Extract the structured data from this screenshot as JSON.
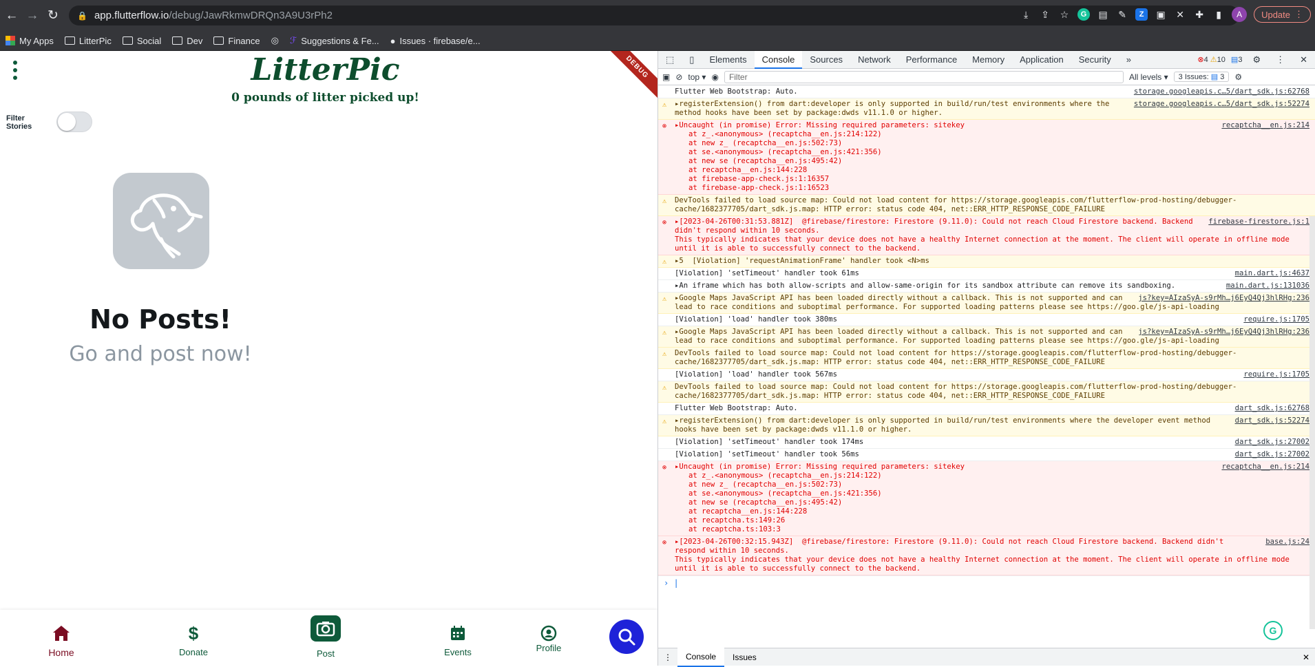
{
  "browser": {
    "url_host": "app.flutterflow.io",
    "url_path": "/debug/JawRkmwDRQn3A9U3rPh2",
    "update_label": "Update",
    "avatar_initial": "A",
    "bookmarks": [
      "My Apps",
      "LitterPic",
      "Social",
      "Dev",
      "Finance",
      "Suggestions & Fe...",
      "Issues · firebase/e..."
    ]
  },
  "app": {
    "title": "LitterPic",
    "tagline": "0 pounds of litter picked up!",
    "filter_label": "Filter Stories",
    "filter_on": false,
    "debug_banner": "DEBUG",
    "empty_title": "No Posts!",
    "empty_subtitle": "Go and post now!",
    "nav": {
      "home": "Home",
      "donate": "Donate",
      "post": "Post",
      "events": "Events",
      "profile": "Profile"
    },
    "colors": {
      "brand": "#0d4d2d",
      "active": "#7a0c22",
      "fab": "#1e22d8"
    }
  },
  "devtools": {
    "tabs": [
      "Elements",
      "Console",
      "Sources",
      "Network",
      "Performance",
      "Memory",
      "Application",
      "Security"
    ],
    "error_count": "4",
    "warning_count": "10",
    "info_count": "3",
    "context": "top",
    "filter_placeholder": "Filter",
    "levels": "All levels",
    "issues_label": "3 Issues:",
    "issues_count": "3",
    "drawer_tabs": [
      "Console",
      "Issues"
    ],
    "messages": [
      {
        "level": "log",
        "text": "Flutter Web Bootstrap: Auto.",
        "src": "storage.googleapis.c…5/dart_sdk.js:62768"
      },
      {
        "level": "warn",
        "text": "▸registerExtension() from dart:developer is only supported in build/run/test environments where the method hooks have been set by package:dwds v11.1.0 or higher.",
        "src": "storage.googleapis.c…5/dart_sdk.js:52274"
      },
      {
        "level": "err",
        "text": "▸Uncaught (in promise) Error: Missing required parameters: sitekey",
        "src": "recaptcha__en.js:214",
        "stack": "at z_.<anonymous> (recaptcha__en.js:214:122)\nat new z_ (recaptcha__en.js:502:73)\nat se.<anonymous> (recaptcha__en.js:421:356)\nat new se (recaptcha__en.js:495:42)\nat recaptcha__en.js:144:228\nat firebase-app-check.js:1:16357\nat firebase-app-check.js:1:16523"
      },
      {
        "level": "warn",
        "text": "DevTools failed to load source map: Could not load content for https://storage.googleapis.com/flutterflow-prod-hosting/debugger-cache/1682377705/dart_sdk.js.map: HTTP error: status code 404, net::ERR_HTTP_RESPONSE_CODE_FAILURE",
        "src": ""
      },
      {
        "level": "err",
        "text": "▸[2023-04-26T00:31:53.881Z]  @firebase/firestore: Firestore (9.11.0): Could not reach Cloud Firestore backend. Backend didn't respond within 10 seconds.\nThis typically indicates that your device does not have a healthy Internet connection at the moment. The client will operate in offline mode until it is able to successfully connect to the backend.",
        "src": "firebase-firestore.js:1"
      },
      {
        "level": "warn",
        "text": "▸5  [Violation] 'requestAnimationFrame' handler took <N>ms",
        "src": ""
      },
      {
        "level": "log",
        "text": "[Violation] 'setTimeout' handler took 61ms",
        "src": "main.dart.js:4637"
      },
      {
        "level": "log",
        "text": "▸An iframe which has both allow-scripts and allow-same-origin for its sandbox attribute can remove its sandboxing.",
        "src": "main.dart.js:131036"
      },
      {
        "level": "warn",
        "text": "▸Google Maps JavaScript API has been loaded directly without a callback. This is not supported and can lead to race conditions and suboptimal performance. For supported loading patterns please see https://goo.gle/js-api-loading",
        "src": "js?key=AIzaSyA-s9rMh…j6EyQ4Qj3hlRHg:236"
      },
      {
        "level": "log",
        "text": "[Violation] 'load' handler took 380ms",
        "src": "require.js:1705"
      },
      {
        "level": "warn",
        "text": "▸Google Maps JavaScript API has been loaded directly without a callback. This is not supported and can lead to race conditions and suboptimal performance. For supported loading patterns please see https://goo.gle/js-api-loading",
        "src": "js?key=AIzaSyA-s9rMh…j6EyQ4Qj3hlRHg:236"
      },
      {
        "level": "warn",
        "text": "DevTools failed to load source map: Could not load content for https://storage.googleapis.com/flutterflow-prod-hosting/debugger-cache/1682377705/dart_sdk.js.map: HTTP error: status code 404, net::ERR_HTTP_RESPONSE_CODE_FAILURE",
        "src": ""
      },
      {
        "level": "log",
        "text": "[Violation] 'load' handler took 567ms",
        "src": "require.js:1705"
      },
      {
        "level": "warn",
        "text": "DevTools failed to load source map: Could not load content for https://storage.googleapis.com/flutterflow-prod-hosting/debugger-cache/1682377705/dart_sdk.js.map: HTTP error: status code 404, net::ERR_HTTP_RESPONSE_CODE_FAILURE",
        "src": ""
      },
      {
        "level": "log",
        "text": "Flutter Web Bootstrap: Auto.",
        "src": "dart_sdk.js:62768"
      },
      {
        "level": "warn",
        "text": "▸registerExtension() from dart:developer is only supported in build/run/test environments where the developer event method hooks have been set by package:dwds v11.1.0 or higher.",
        "src": "dart_sdk.js:52274"
      },
      {
        "level": "log",
        "text": "[Violation] 'setTimeout' handler took 174ms",
        "src": "dart_sdk.js:27002"
      },
      {
        "level": "log",
        "text": "[Violation] 'setTimeout' handler took 56ms",
        "src": "dart_sdk.js:27002"
      },
      {
        "level": "err",
        "text": "▸Uncaught (in promise) Error: Missing required parameters: sitekey",
        "src": "recaptcha__en.js:214",
        "stack": "at z_.<anonymous> (recaptcha__en.js:214:122)\nat new z_ (recaptcha__en.js:502:73)\nat se.<anonymous> (recaptcha__en.js:421:356)\nat new se (recaptcha__en.js:495:42)\nat recaptcha__en.js:144:228\nat recaptcha.ts:149:26\nat recaptcha.ts:103:3"
      },
      {
        "level": "err",
        "text": "▸[2023-04-26T00:32:15.943Z]  @firebase/firestore: Firestore (9.11.0): Could not reach Cloud Firestore backend. Backend didn't respond within 10 seconds.\nThis typically indicates that your device does not have a healthy Internet connection at the moment. The client will operate in offline mode until it is able to successfully connect to the backend.",
        "src": "base.js:24"
      }
    ]
  }
}
